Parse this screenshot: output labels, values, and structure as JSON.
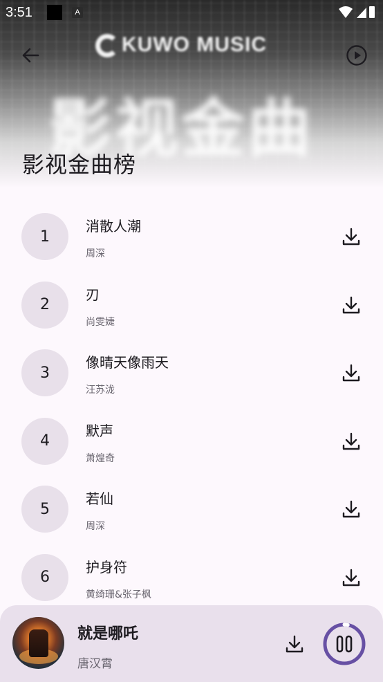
{
  "status_bar": {
    "time": "3:51",
    "notification_icon": "A"
  },
  "header": {
    "brand": "KUWO MUSIC",
    "banner_art_text": "影视金曲",
    "title": "影视金曲榜",
    "back_icon": "arrow-left-icon",
    "play_icon": "play-circle-icon"
  },
  "songs": [
    {
      "rank": "1",
      "title": "消散人潮",
      "artist": "周深"
    },
    {
      "rank": "2",
      "title": "刃",
      "artist": "尚雯婕"
    },
    {
      "rank": "3",
      "title": "像晴天像雨天",
      "artist": "汪苏泷"
    },
    {
      "rank": "4",
      "title": "默声",
      "artist": "萧煌奇"
    },
    {
      "rank": "5",
      "title": "若仙",
      "artist": "周深"
    },
    {
      "rank": "6",
      "title": "护身符",
      "artist": "黄绮珊&张子枫"
    }
  ],
  "now_playing": {
    "title": "就是哪吒",
    "artist": "唐汉霄",
    "progress": 0.03,
    "accent_color": "#6750a4"
  },
  "colors": {
    "background": "#fdf8fd",
    "badge": "#e8e0ea",
    "player_bg": "#e9e0ec",
    "text_primary": "#1d1b20",
    "text_secondary": "#6a6670"
  }
}
